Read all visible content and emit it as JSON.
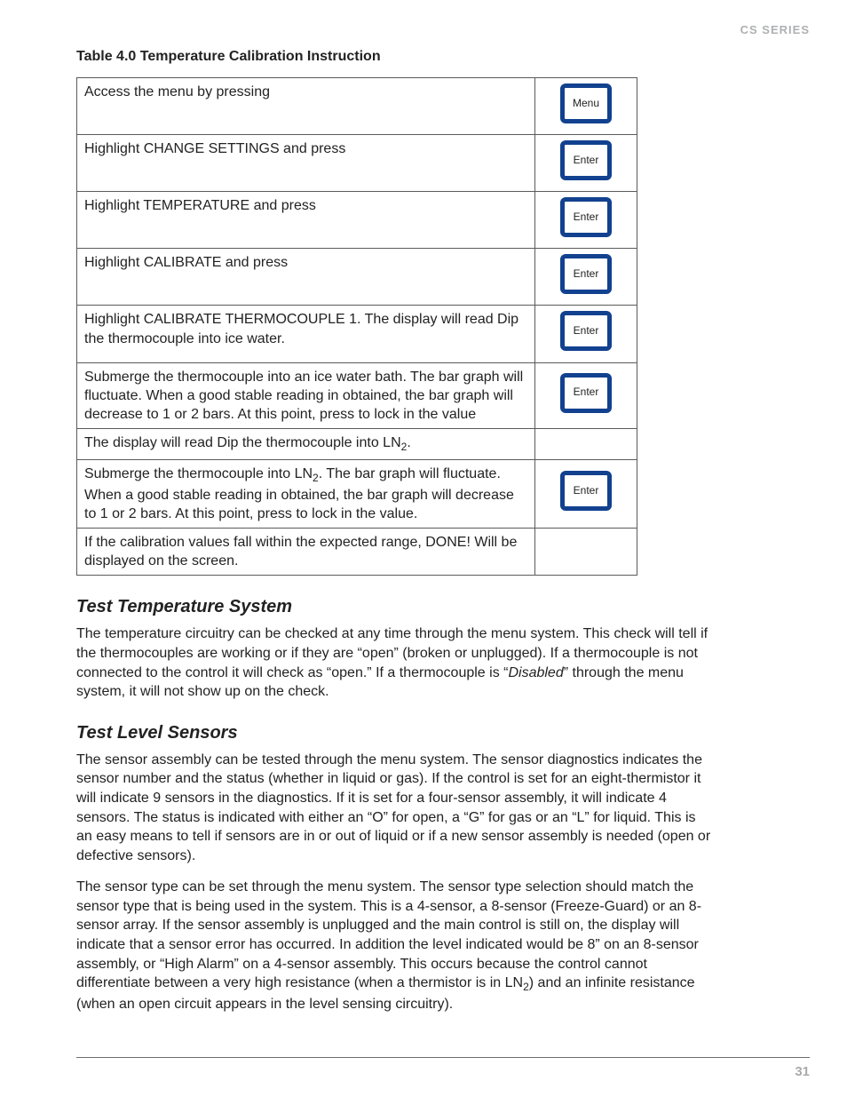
{
  "running_head": "CS SERIES",
  "table_title": "Table 4.0 Temperature Calibration Instruction",
  "rows": [
    {
      "text": "Access the menu by pressing",
      "button": "Menu"
    },
    {
      "text": "Highlight CHANGE SETTINGS and press",
      "button": "Enter"
    },
    {
      "text": "Highlight TEMPERATURE and press",
      "button": "Enter"
    },
    {
      "text": "Highlight CALIBRATE and press",
      "button": "Enter"
    },
    {
      "text": "Highlight CALIBRATE THERMOCOUPLE 1. The display will read Dip the thermocouple into ice water.",
      "button": "Enter"
    },
    {
      "text": "Submerge the thermocouple into an ice water bath. The bar graph will fluctuate. When a good stable reading in obtained, the bar graph will decrease to 1 or 2 bars. At this point, press to lock in the value",
      "button": "Enter"
    },
    {
      "html": "The display will read Dip the thermocouple into LN<span class=\"sub\">2</span>.",
      "button": null
    },
    {
      "html": "Submerge the thermocouple into LN<span class=\"sub\">2</span>. The bar graph will fluctuate. When a good stable reading in obtained, the bar graph will decrease to 1 or 2 bars. At this point, press to lock in the value.",
      "button": "Enter"
    },
    {
      "text": "If the calibration values fall within the expected range, DONE! Will be displayed on the screen.",
      "button": null
    }
  ],
  "sections": [
    {
      "heading": "Test Temperature System",
      "paragraphs_html": [
        "The temperature circuitry can be checked at any time through the menu system. This check will tell if the thermocouples are working or if they are “open” (broken or unplugged). If a thermocouple is not connected to the control it will check as “open.” If a thermocouple is “<span class=\"em\">Disabled</span>” through the menu system, it will not show up on the check."
      ]
    },
    {
      "heading": "Test Level Sensors",
      "paragraphs_html": [
        "The sensor assembly can be tested through the menu system. The sensor diagnostics indicates the sensor number and the status (whether in liquid or gas). If the control is set for an eight-thermistor it will indicate 9 sensors in the diagnostics. If it is set for a four-sensor assembly, it will indicate 4 sensors. The status is indicated with either an “O” for open, a “G” for gas or an “L” for liquid. This is an easy means to tell if sensors are in or out of liquid or if a new sensor assembly is needed (open or defective sensors).",
        "The sensor type can be set through the menu system. The sensor type selection should match the sensor type that is being used in the system. This is a 4-sensor, a 8-sensor (Freeze-Guard) or an 8-sensor array. If the sensor assembly is unplugged and the main control is still on, the display will indicate that a sensor error has occurred. In addition the level indicated would be 8” on an 8-sensor assembly, or “High Alarm” on a 4-sensor assembly. This occurs because the control cannot differentiate between a very high resistance (when a thermistor is in LN<span class=\"sub\">2</span>) and an infinite resistance (when an open circuit appears in the level sensing circuitry)."
      ]
    }
  ],
  "page_number": "31",
  "padded_row_indices": [
    0,
    1,
    2,
    3
  ]
}
